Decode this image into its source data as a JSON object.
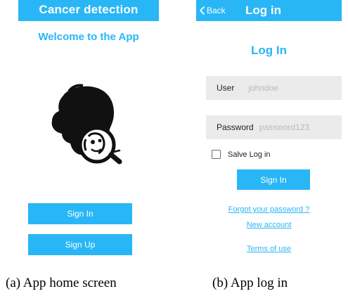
{
  "home": {
    "title": "Cancer detection",
    "welcome": "Welcome to the App",
    "logo_icon": "head-magnifier-logo-icon",
    "signin_label": "Sign In",
    "signup_label": "Sign Up"
  },
  "login": {
    "back_label": "Back",
    "back_icon": "chevron-left-icon",
    "title": "Log in",
    "heading": "Log In",
    "user_label": "User",
    "user_placeholder": "johndoe",
    "password_label": "Password",
    "password_placeholder": "password123",
    "remember_label": "Salve Log in",
    "signin_label": "Sign In",
    "forgot_link": "Forgot your password ?",
    "new_account_link": "New account",
    "terms_link": "Terms of use"
  },
  "captions": {
    "a": "(a) App home screen",
    "b": "(b) App log in"
  },
  "colors": {
    "accent": "#29b6f6",
    "field_bg": "#ebebeb",
    "placeholder": "#b9b9b9"
  }
}
